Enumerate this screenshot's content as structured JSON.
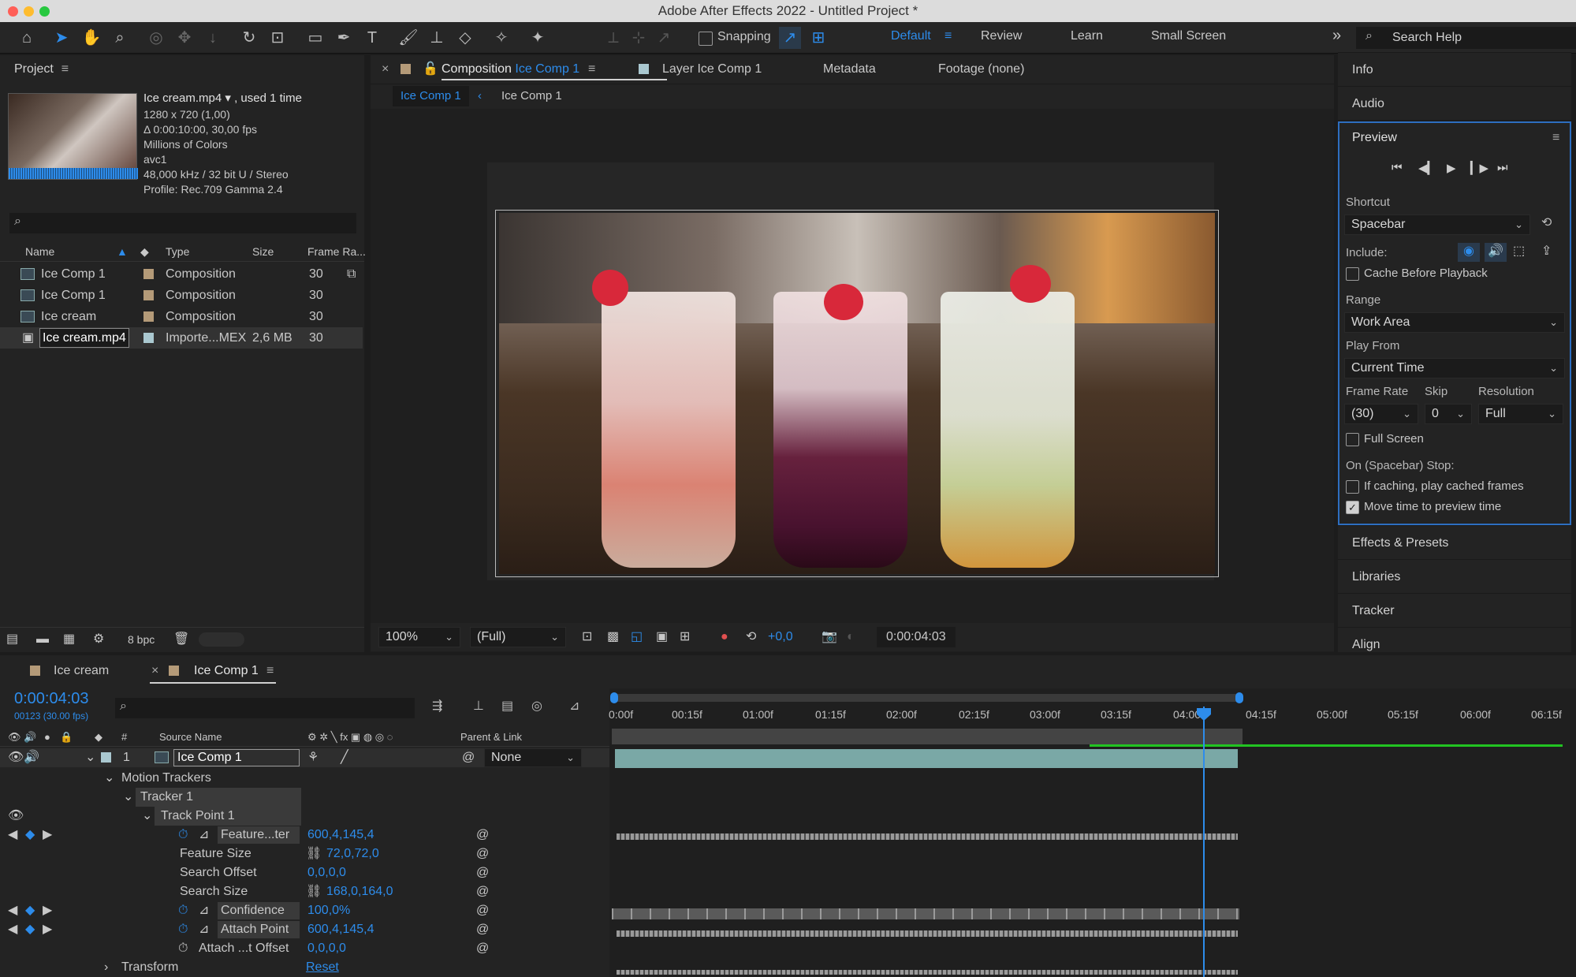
{
  "window_title": "Adobe After Effects 2022 - Untitled Project *",
  "workspaces": [
    "Default",
    "Review",
    "Learn",
    "Small Screen"
  ],
  "toolbar": {
    "snapping": "Snapping",
    "search_help": "Search Help"
  },
  "project": {
    "title": "Project",
    "footage_name": "Ice cream.mp4 ▾ , used 1 time",
    "info_lines": [
      "1280 x 720 (1,00)",
      "Δ 0:00:10:00, 30,00 fps",
      "Millions of Colors",
      "avc1",
      "48,000 kHz / 32 bit U / Stereo",
      "Profile: Rec.709 Gamma 2.4"
    ],
    "columns": [
      "Name",
      "Type",
      "Size",
      "Frame Ra..."
    ],
    "items": [
      {
        "name": "Ice Comp 1",
        "type": "Composition",
        "size": "",
        "fps": "30"
      },
      {
        "name": "Ice Comp 1",
        "type": "Composition",
        "size": "",
        "fps": "30"
      },
      {
        "name": "Ice cream",
        "type": "Composition",
        "size": "",
        "fps": "30"
      },
      {
        "name": "Ice cream.mp4",
        "type": "Importe...MEX",
        "size": "2,6 MB",
        "fps": "30"
      }
    ],
    "bpc": "8 bpc"
  },
  "viewer": {
    "tabs": [
      "Composition",
      "Ice Comp 1",
      "Layer Ice Comp 1",
      "Metadata",
      "Footage (none)"
    ],
    "breadcrumbs": [
      "Ice Comp 1",
      "Ice Comp 1"
    ],
    "zoom": "100%",
    "resolution": "(Full)",
    "exposure": "+0,0",
    "timecode": "0:00:04:03"
  },
  "right_panels": {
    "info": "Info",
    "audio": "Audio",
    "preview": {
      "title": "Preview",
      "shortcut_label": "Shortcut",
      "shortcut": "Spacebar",
      "include_label": "Include:",
      "cache_label": "Cache Before Playback",
      "range_label": "Range",
      "range": "Work Area",
      "playfrom_label": "Play From",
      "playfrom": "Current Time",
      "framerate_label": "Frame Rate",
      "skip_label": "Skip",
      "resolution_label": "Resolution",
      "framerate": "(30)",
      "skip": "0",
      "resolution": "Full",
      "fullscreen_label": "Full Screen",
      "stop_label": "On (Spacebar) Stop:",
      "if_caching_label": "If caching, play cached frames",
      "move_time_label": "Move time to preview time"
    },
    "sections": [
      "Effects & Presets",
      "Libraries",
      "Tracker",
      "Align"
    ]
  },
  "timeline": {
    "tabs": [
      "Ice cream",
      "Ice Comp 1"
    ],
    "timecode": "0:00:04:03",
    "frame_info": "00123 (30.00 fps)",
    "col_source": "Source Name",
    "col_parent": "Parent & Link",
    "layer_number": "1",
    "layer_name": "Ice Comp 1",
    "parent_value": "None",
    "ruler": [
      "0:00f",
      "00:15f",
      "01:00f",
      "01:15f",
      "02:00f",
      "02:15f",
      "03:00f",
      "03:15f",
      "04:00f",
      "04:15f",
      "05:00f",
      "05:15f",
      "06:00f",
      "06:15f"
    ],
    "rows": [
      {
        "label": "Motion Trackers",
        "value": ""
      },
      {
        "label": "Tracker 1",
        "value": ""
      },
      {
        "label": "Track Point 1",
        "value": ""
      },
      {
        "label": "Feature...ter",
        "value": "600,4,145,4"
      },
      {
        "label": "Feature Size",
        "value": "72,0,72,0"
      },
      {
        "label": "Search Offset",
        "value": "0,0,0,0"
      },
      {
        "label": "Search Size",
        "value": "168,0,164,0"
      },
      {
        "label": "Confidence",
        "value": "100,0%"
      },
      {
        "label": "Attach Point",
        "value": "600,4,145,4"
      },
      {
        "label": "Attach ...t Offset",
        "value": "0,0,0,0"
      },
      {
        "label": "Transform",
        "value": "Reset"
      }
    ]
  }
}
